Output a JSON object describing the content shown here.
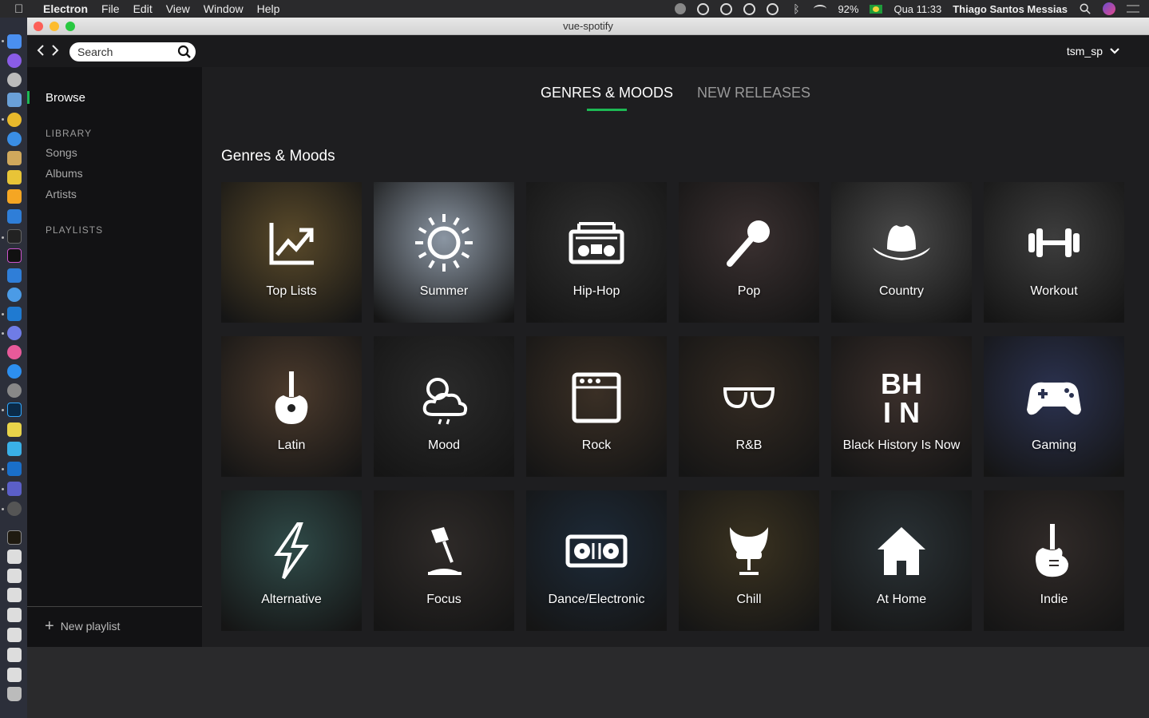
{
  "menubar": {
    "apple": "",
    "app_name": "Electron",
    "menus": [
      "File",
      "Edit",
      "View",
      "Window",
      "Help"
    ],
    "battery": "92%",
    "clock": "Qua 11:33",
    "user_name": "Thiago Santos Messias"
  },
  "window": {
    "title": "vue-spotify"
  },
  "topbar": {
    "back": "‹",
    "forward": "›",
    "search_placeholder": "Search",
    "username": "tsm_sp",
    "dropdown": "⌄"
  },
  "sidebar": {
    "browse": "Browse",
    "library_heading": "LIBRARY",
    "library_items": [
      "Songs",
      "Albums",
      "Artists"
    ],
    "playlists_heading": "PLAYLISTS",
    "new_playlist": "New playlist",
    "plus": "+"
  },
  "main": {
    "tabs": [
      {
        "label": "GENRES & MOODS",
        "active": true
      },
      {
        "label": "NEW RELEASES",
        "active": false
      }
    ],
    "section_title": "Genres & Moods",
    "tiles": [
      {
        "label": "Top Lists",
        "icon": "trend-up-icon",
        "bg": "#5a4a2a"
      },
      {
        "label": "Summer",
        "icon": "sun-icon",
        "bg": "#8b96a3"
      },
      {
        "label": "Hip-Hop",
        "icon": "boombox-icon",
        "bg": "#2f2f2f"
      },
      {
        "label": "Pop",
        "icon": "microphone-icon",
        "bg": "#3a3030"
      },
      {
        "label": "Country",
        "icon": "cowboy-hat-icon",
        "bg": "#4a4a4a"
      },
      {
        "label": "Workout",
        "icon": "dumbbell-icon",
        "bg": "#3d3d3d"
      },
      {
        "label": "Latin",
        "icon": "guitar-icon",
        "bg": "#4b3a2c"
      },
      {
        "label": "Mood",
        "icon": "cloud-sun-icon",
        "bg": "#2a2a2a"
      },
      {
        "label": "Rock",
        "icon": "amplifier-icon",
        "bg": "#3a2f25"
      },
      {
        "label": "R&B",
        "icon": "sunglasses-icon",
        "bg": "#332a22"
      },
      {
        "label": "Black History Is Now",
        "icon": "bhin-logo-icon",
        "bg": "#3a2f2b"
      },
      {
        "label": "Gaming",
        "icon": "gamepad-icon",
        "bg": "#2b3250"
      },
      {
        "label": "Alternative",
        "icon": "lightning-icon",
        "bg": "#2f4a48"
      },
      {
        "label": "Focus",
        "icon": "desk-lamp-icon",
        "bg": "#2e2a28"
      },
      {
        "label": "Dance/Electronic",
        "icon": "turntable-icon",
        "bg": "#1d2a38"
      },
      {
        "label": "Chill",
        "icon": "egg-chair-icon",
        "bg": "#3a3220"
      },
      {
        "label": "At Home",
        "icon": "house-icon",
        "bg": "#2a3236"
      },
      {
        "label": "Indie",
        "icon": "electric-guitar-icon",
        "bg": "#302a28"
      }
    ]
  },
  "colors": {
    "accent": "#1db954",
    "sidebar_bg": "#121214",
    "main_bg": "#1e1e20"
  }
}
